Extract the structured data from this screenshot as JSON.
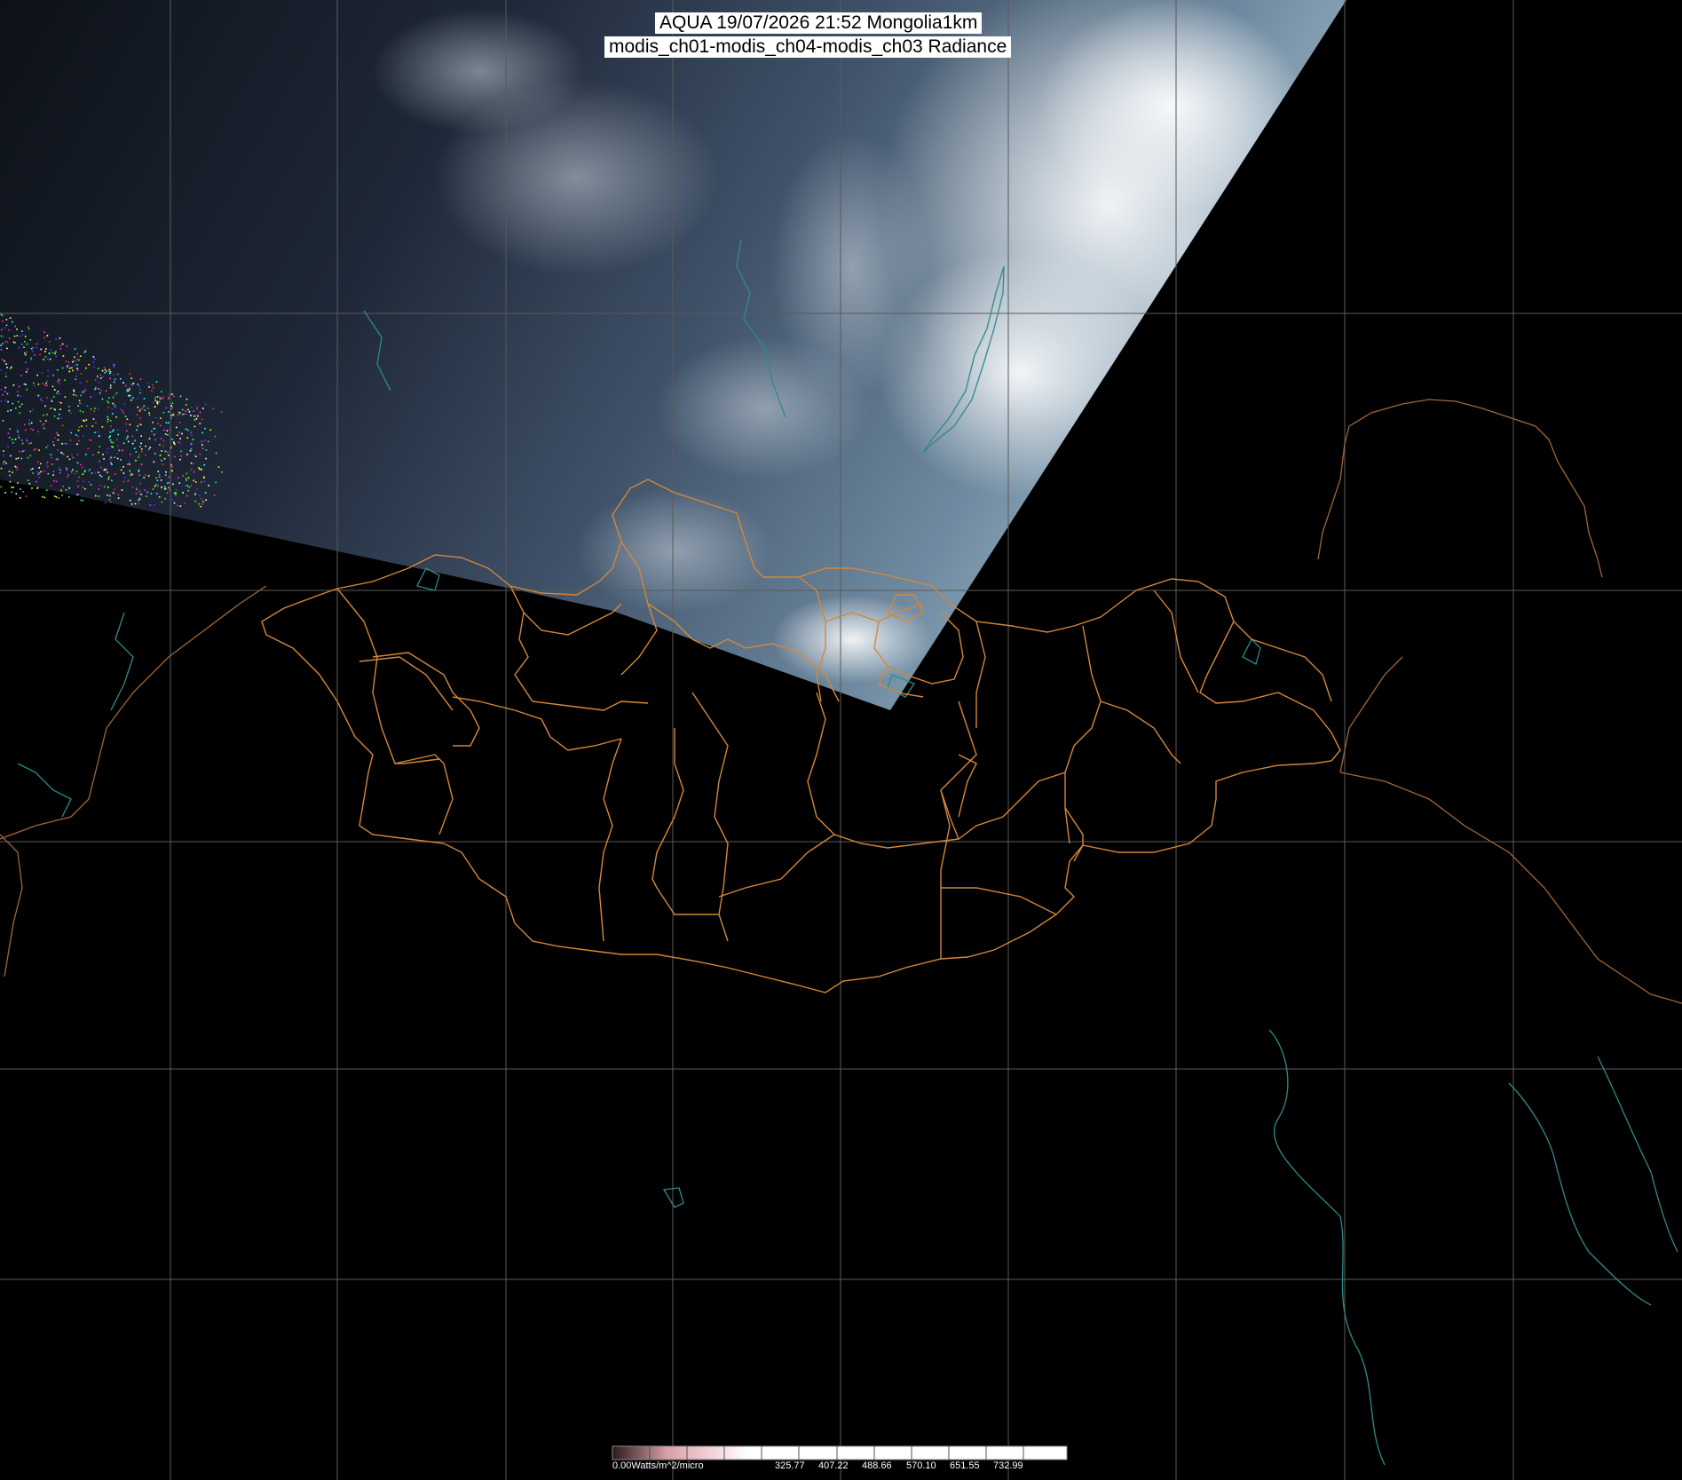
{
  "header": {
    "title_line1": "AQUA 19/07/2026 21:52 Mongolia1km",
    "title_line2": "modis_ch01-modis_ch04-modis_ch03 Radiance"
  },
  "legend": {
    "min_label": "0.00Watts/m^2/micro",
    "tick_labels": [
      "325.77",
      "407.22",
      "488.66",
      "570.10",
      "651.55",
      "732.99"
    ]
  },
  "colors": {
    "background": "#000000",
    "grid": "#5a5a5a",
    "province_borders": "#d4873a",
    "coastlines": "#2f8a8a",
    "country_borders": "#a0663a",
    "cloud": "#e8eef5",
    "land_image": "#3d4a5e"
  }
}
